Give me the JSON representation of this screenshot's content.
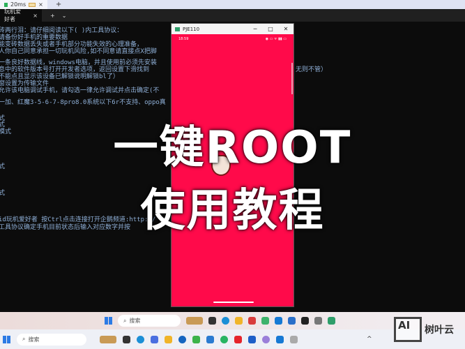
{
  "browser_tab": {
    "label": "20ms",
    "new_tab": "+",
    "close": "×"
  },
  "terminal": {
    "tab_label": "玩机爱好者",
    "tab_close": "×",
    "new_tab": "+",
    "dropdown": "⌄",
    "lines": [
      "砖两行泪：请仔细阅读以下( )内工具协议：",
      "请备份好手机的重要数据",
      "能变砖数据丢失或者手机部分功能失效的心理准备，",
      "人你自己同意承担一切玩机风险,如不同意请直接点X把脚",
      "一条良好数据线，windows电脑，并且使用前必须先安装",
      "息中的软件版本号打开开发者选项，返回设置下滑找到",
      "无则不管）",
      "不能点且显示该设备已解锁说明解锁bl了）",
      "窗设置为传输文件",
      "允许该电脑调试手机，请勾选一律允许调试并点击确定(不",
      "一加、红魔3-5-6-7-8pro8.0系统以下6r不支持、oppo真",
      "式",
      "式",
      "模式",
      "式",
      "式",
      "id玩机爱好者 按Ctrl点击连接打开企鹅频道:http://",
      "工具协议确定手机目前状态后输入对应数字并按"
    ]
  },
  "phone_window": {
    "title": "PJE110",
    "time": "18:59",
    "status_icons": "◉ ▭ ᯤ ▮▮ ▭"
  },
  "overlay": {
    "line1": "一键ROOT",
    "line2": "使用教程"
  },
  "taskbar": {
    "search_placeholder": "搜索"
  },
  "watermark": {
    "logo": "AI",
    "text": "树叶云"
  }
}
